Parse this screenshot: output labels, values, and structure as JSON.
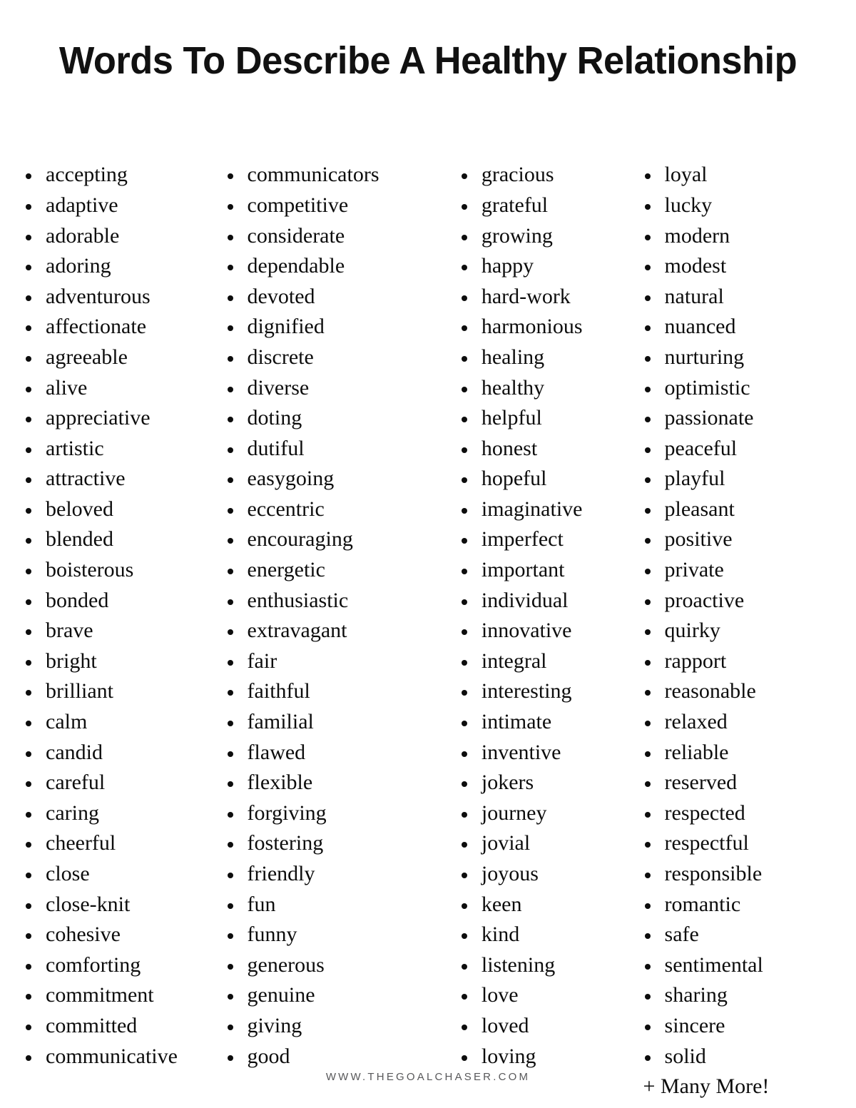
{
  "page": {
    "title": "Words To Describe A Healthy Relationship",
    "bullet_glyph": "•",
    "text_color": "#0d0d0d",
    "background_color": "#ffffff",
    "footer_color": "#58585a"
  },
  "columns": [
    {
      "id": "column-1",
      "items": [
        "accepting",
        "adaptive",
        "adorable",
        "adoring",
        "adventurous",
        "affectionate",
        "agreeable",
        "alive",
        "appreciative",
        "artistic",
        "attractive",
        "beloved",
        "blended",
        "boisterous",
        "bonded",
        "brave",
        "bright",
        "brilliant",
        "calm",
        "candid",
        "careful",
        "caring",
        "cheerful",
        "close",
        "close-knit",
        "cohesive",
        "comforting",
        "commitment",
        "committed",
        "communicative"
      ]
    },
    {
      "id": "column-2",
      "items": [
        "communicators",
        "competitive",
        "considerate",
        "dependable",
        "devoted",
        "dignified",
        "discrete",
        "diverse",
        "doting",
        "dutiful",
        "easygoing",
        "eccentric",
        "encouraging",
        "energetic",
        "enthusiastic",
        "extravagant",
        "fair",
        "faithful",
        "familial",
        "flawed",
        "flexible",
        "forgiving",
        "fostering",
        "friendly",
        "fun",
        "funny",
        "generous",
        "genuine",
        "giving",
        "good"
      ]
    },
    {
      "id": "column-3",
      "items": [
        "gracious",
        "grateful",
        "growing",
        "happy",
        "hard-work",
        "harmonious",
        "healing",
        "healthy",
        "helpful",
        "honest",
        "hopeful",
        "imaginative",
        "imperfect",
        "important",
        "individual",
        "innovative",
        "integral",
        "interesting",
        "intimate",
        "inventive",
        "jokers",
        "journey",
        "jovial",
        "joyous",
        "keen",
        "kind",
        "listening",
        "love",
        "loved",
        "loving"
      ]
    },
    {
      "id": "column-4",
      "items": [
        "loyal",
        "lucky",
        "modern",
        "modest",
        "natural",
        "nuanced",
        "nurturing",
        "optimistic",
        "passionate",
        "peaceful",
        "playful",
        "pleasant",
        "positive",
        "private",
        "proactive",
        "quirky",
        "rapport",
        "reasonable",
        "relaxed",
        "reliable",
        "reserved",
        "respected",
        "respectful",
        "responsible",
        "romantic",
        "safe",
        "sentimental",
        "sharing",
        "sincere",
        "solid"
      ],
      "trailing_note": "+ Many More!"
    }
  ],
  "footer": {
    "url": "WWW.THEGOALCHASER.COM"
  }
}
